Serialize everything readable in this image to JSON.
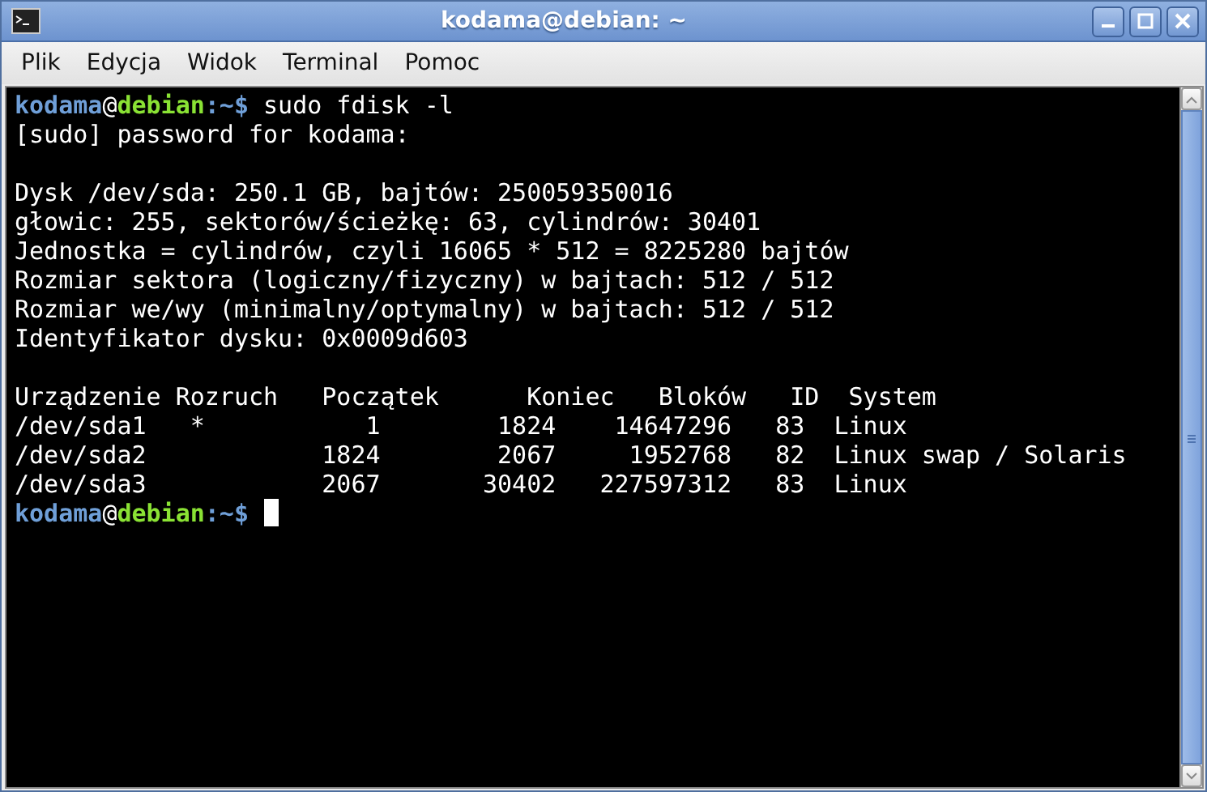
{
  "window": {
    "title": "kodama@debian: ~"
  },
  "menu": [
    {
      "label": "Plik"
    },
    {
      "label": "Edycja"
    },
    {
      "label": "Widok"
    },
    {
      "label": "Terminal"
    },
    {
      "label": "Pomoc"
    }
  ],
  "terminal": {
    "lines": [
      {
        "kind": "prompt",
        "user": "kodama",
        "at": "@",
        "host": "debian",
        "path": ":~$",
        "command": " sudo fdisk -l",
        "cursor": false
      },
      {
        "kind": "text",
        "text": "[sudo] password for kodama:"
      },
      {
        "kind": "blank"
      },
      {
        "kind": "text",
        "text": "Dysk /dev/sda: 250.1 GB, bajtów: 250059350016"
      },
      {
        "kind": "text",
        "text": "głowic: 255, sektorów/ścieżkę: 63, cylindrów: 30401"
      },
      {
        "kind": "text",
        "text": "Jednostka = cylindrów, czyli 16065 * 512 = 8225280 bajtów"
      },
      {
        "kind": "text",
        "text": "Rozmiar sektora (logiczny/fizyczny) w bajtach: 512 / 512"
      },
      {
        "kind": "text",
        "text": "Rozmiar we/wy (minimalny/optymalny) w bajtach: 512 / 512"
      },
      {
        "kind": "text",
        "text": "Identyfikator dysku: 0x0009d603"
      },
      {
        "kind": "blank"
      },
      {
        "kind": "text",
        "text": "Urządzenie Rozruch   Początek      Koniec   Bloków   ID  System"
      },
      {
        "kind": "text",
        "text": "/dev/sda1   *           1        1824    14647296   83  Linux"
      },
      {
        "kind": "text",
        "text": "/dev/sda2            1824        2067     1952768   82  Linux swap / Solaris"
      },
      {
        "kind": "text",
        "text": "/dev/sda3            2067       30402   227597312   83  Linux"
      },
      {
        "kind": "prompt",
        "user": "kodama",
        "at": "@",
        "host": "debian",
        "path": ":~$",
        "cursor": true
      }
    ]
  }
}
